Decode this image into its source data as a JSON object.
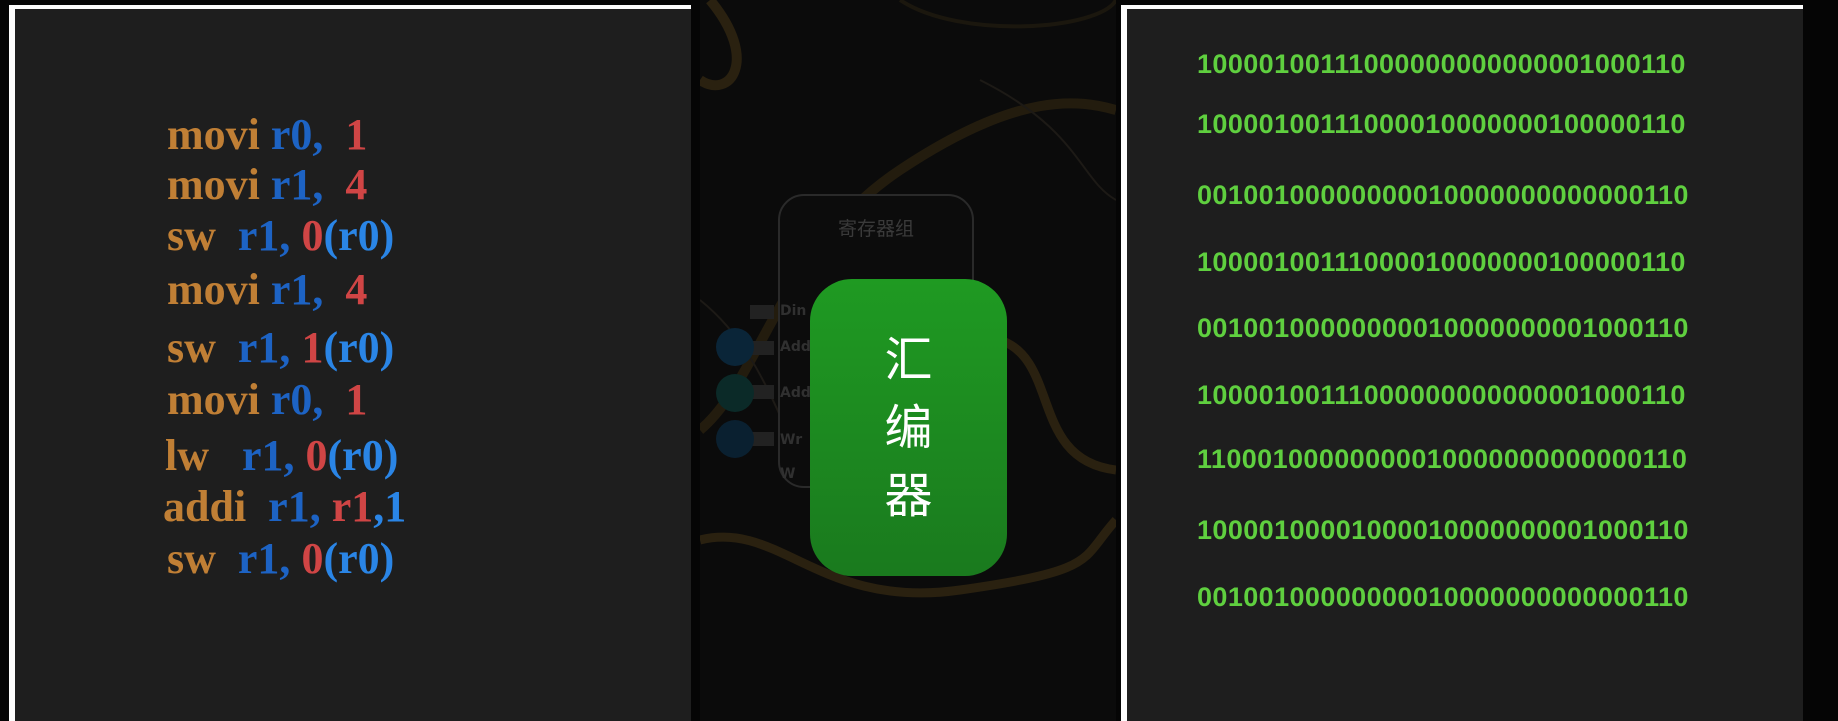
{
  "left_panel": {
    "lines": [
      [
        "movi",
        "r0,",
        "1"
      ],
      [
        "movi",
        "r1,",
        "4"
      ],
      [
        "sw",
        "r1,",
        "0",
        "(r0)"
      ],
      [
        "movi",
        "r1,",
        "4"
      ],
      [
        "sw",
        "r1,",
        "1",
        "(r0)"
      ],
      [
        "movi",
        "r0,",
        "1"
      ],
      [
        "lw",
        "r1,",
        "0",
        "(r0)"
      ],
      [
        "addi",
        "r1,",
        "r1",
        ",1"
      ],
      [
        "sw",
        "r1,",
        "0",
        "(r0)"
      ]
    ]
  },
  "middle_panel": {
    "register_box_title": "寄存器组",
    "pin_labels": [
      "Din",
      "Add",
      "Add",
      "Wr",
      "W"
    ],
    "assembler_chars": [
      "汇",
      "编",
      "器"
    ],
    "assembler_color": "#1f9a22"
  },
  "right_panel": {
    "binary_lines": [
      "10000100111000000000000001000110",
      "10000100111000010000000100000110",
      "00100100000000010000000000000110",
      "10000100111000010000000100000110",
      "00100100000000010000000001000110",
      "10000100111000000000000001000110",
      "11000100000000010000000000000110",
      "10000100001000010000000001000110",
      "00100100000000010000000000000110"
    ]
  }
}
